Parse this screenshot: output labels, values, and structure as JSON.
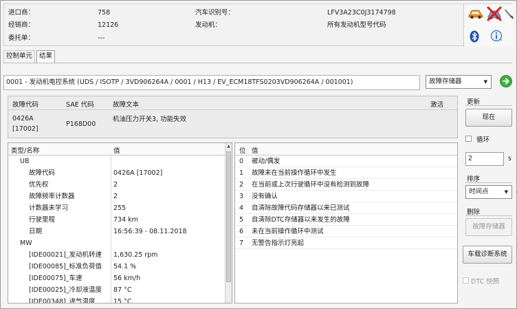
{
  "header": {
    "importer_label": "进口商：",
    "importer_value": "758",
    "dealer_label": "经销商：",
    "dealer_value": "12126",
    "order_label": "委托单：",
    "order_value": "---",
    "vin_label": "汽车识别号：",
    "vin_value": "LFV3A23C0J3174798",
    "engine_label": "发动机：",
    "engine_value": "所有发动机型号代码",
    "icons": [
      "car-icon",
      "disconnected-car-icon",
      "bluetooth-icon",
      "info-icon"
    ],
    "icon_colors": {
      "car": "#f08a1c",
      "cross": "#e01818",
      "bluetooth": "#1a4fb0",
      "info": "#2a6fc8"
    }
  },
  "tabs": [
    {
      "label": "控制单元",
      "active": false
    },
    {
      "label": "结果",
      "active": true
    }
  ],
  "path": {
    "text": "0001 - 发动机电控系统  (UDS / ISOTP / 3VD906264A / 0001 / H13 / EV_ECM18TFS0203VD906264A / 001001)",
    "memory_select": "故障存储器"
  },
  "fault_table": {
    "columns": [
      "故障代码",
      "SAE 代码",
      "故障文本",
      "激活"
    ],
    "row": {
      "code": "0426A",
      "code_sub": "[17002]",
      "sae": "P168D00",
      "text": "机油压力开关3, 功能失效",
      "active": ""
    }
  },
  "details": {
    "columns": [
      "类型/名称",
      "值"
    ],
    "rows": [
      {
        "name": "UB",
        "value": "",
        "level": 1
      },
      {
        "name": "故障代码",
        "value": "0426A [17002]",
        "level": 2
      },
      {
        "name": "优先权",
        "value": "2",
        "level": 2
      },
      {
        "name": "故障频率计数器",
        "value": "2",
        "level": 2
      },
      {
        "name": "计数器未学习",
        "value": "255",
        "level": 2
      },
      {
        "name": "行驶里程",
        "value": "734 km",
        "level": 2
      },
      {
        "name": "日期",
        "value": "16:56:39 - 08.11.2018",
        "level": 2
      },
      {
        "name": "MW",
        "value": "",
        "level": 1
      },
      {
        "name": "[IDE00021]_发动机转速",
        "value": "1,630.25 rpm",
        "level": 2
      },
      {
        "name": "[IDE00085]_标准负荷值",
        "value": "54.1 %",
        "level": 2
      },
      {
        "name": "[IDE00075]_车速",
        "value": "56 km/h",
        "level": 2
      },
      {
        "name": "[IDE00025]_冷却液温度",
        "value": "87 °C",
        "level": 2
      },
      {
        "name": "[IDE00348]_进气温度",
        "value": "15 °C",
        "level": 2
      }
    ]
  },
  "status_bits": {
    "columns": [
      "位",
      "值"
    ],
    "rows": [
      {
        "bit": "0",
        "text": "被动/偶发"
      },
      {
        "bit": "1",
        "text": "故障未在当前操作循环中发生"
      },
      {
        "bit": "2",
        "text": "在当前或上次行驶循环中没有检测到故障"
      },
      {
        "bit": "3",
        "text": "没有确认"
      },
      {
        "bit": "4",
        "text": "自清除故障代码存储器以来已测试"
      },
      {
        "bit": "5",
        "text": "自清除DTC存储器以来发生的故障"
      },
      {
        "bit": "6",
        "text": "未在当前操作循环中测试"
      },
      {
        "bit": "7",
        "text": "无警告指示灯亮起"
      }
    ]
  },
  "sidebar": {
    "update_label": "更新",
    "now_button": "现在",
    "cycle_label": "循环",
    "interval_value": "2",
    "interval_unit": "s",
    "sort_label": "排序",
    "sort_value": "时间点",
    "delete_label": "删除",
    "delete_memory_button": "故障存储器",
    "obd_button": "车载诊断系统",
    "dtc_snapshot_label": "DTC 快照"
  }
}
